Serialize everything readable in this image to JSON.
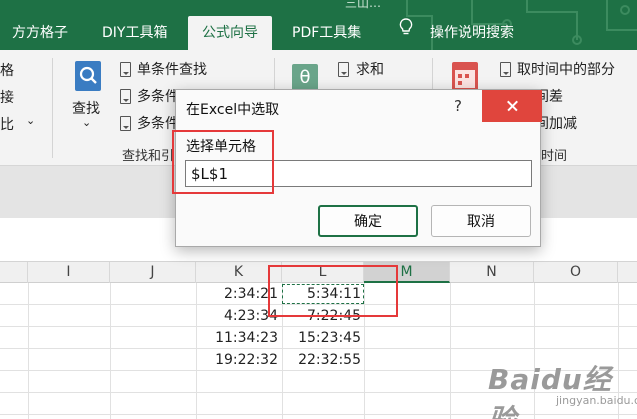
{
  "top_fragment": "三山…",
  "tabs": [
    {
      "label": "方方格子"
    },
    {
      "label": "DIY工具箱"
    },
    {
      "label": "公式向导",
      "active": true
    },
    {
      "label": "PDF工具集"
    },
    {
      "label": "操作说明搜索"
    }
  ],
  "ribbon": {
    "left_fragments": [
      "格",
      "接",
      "比"
    ],
    "lookup_label": "查找",
    "group1_items": [
      "单条件查找",
      "多条件",
      "多条件"
    ],
    "group1_label": "查找和引",
    "sum_label": "求和",
    "time_items": [
      "取时间中的部分",
      "间差",
      "间加减"
    ],
    "time_group_label": "时间"
  },
  "columns": [
    "I",
    "J",
    "K",
    "L",
    "M",
    "N",
    "O"
  ],
  "selected_column": "M",
  "rows": [
    {
      "k": "2:34:21",
      "l": "5:34:11"
    },
    {
      "k": "4:23:34",
      "l": "7:22:45"
    },
    {
      "k": "11:34:23",
      "l": "15:23:45"
    },
    {
      "k": "19:22:32",
      "l": "22:32:55"
    }
  ],
  "dialog": {
    "title": "在Excel中选取",
    "help": "?",
    "label": "选择单元格",
    "value": "$L$1",
    "ok": "确定",
    "cancel": "取消"
  },
  "colors": {
    "accent": "#1e7145",
    "highlight": "#e5393a",
    "close": "#e0453d"
  },
  "watermark": {
    "main": "Baidu经验",
    "sub": "jingyan.baidu.com"
  }
}
